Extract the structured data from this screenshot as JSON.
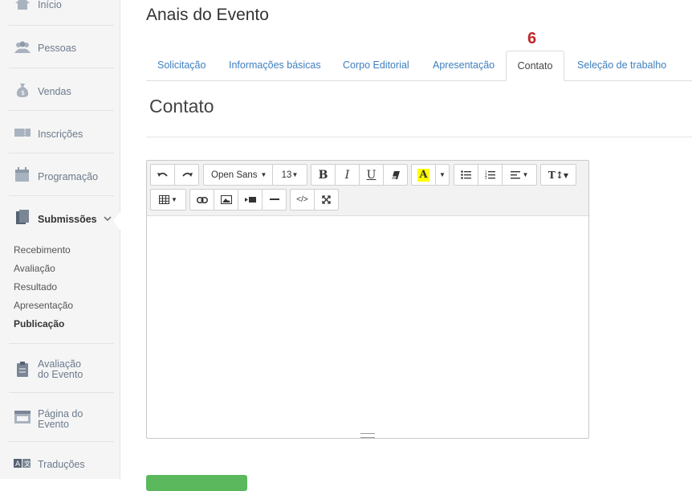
{
  "sidebar": {
    "items": [
      {
        "label": "Início",
        "icon": "home-icon"
      },
      {
        "label": "Pessoas",
        "icon": "people-icon"
      },
      {
        "label": "Vendas",
        "icon": "money-bag-icon"
      },
      {
        "label": "Inscrições",
        "icon": "ticket-icon"
      },
      {
        "label": "Programação",
        "icon": "calendar-icon"
      },
      {
        "label": "Submissões",
        "icon": "documents-icon"
      },
      {
        "label": "Avaliação\ndo Evento",
        "icon": "clipboard-icon"
      },
      {
        "label": "Página do\nEvento",
        "icon": "browser-icon"
      },
      {
        "label": "Traduções",
        "icon": "translate-icon"
      }
    ],
    "submenu": [
      "Recebimento",
      "Avaliação",
      "Resultado",
      "Apresentação",
      "Publicação"
    ]
  },
  "page": {
    "title": "Anais do Evento",
    "marker": "6",
    "section_title": "Contato"
  },
  "tabs": [
    "Solicitação",
    "Informações básicas",
    "Corpo Editorial",
    "Apresentação",
    "Contato",
    "Seleção de trabalho"
  ],
  "editor": {
    "font_family": "Open Sans",
    "font_size": "13",
    "bold": "B",
    "italic": "I",
    "underline": "U",
    "color_letter": "A",
    "text_style": "T↕",
    "code": "</>"
  },
  "colors": {
    "accent": "#3e7fbf",
    "marker": "#c0282a",
    "highlight": "#ffff00",
    "primary_button": "#5cb85c"
  }
}
